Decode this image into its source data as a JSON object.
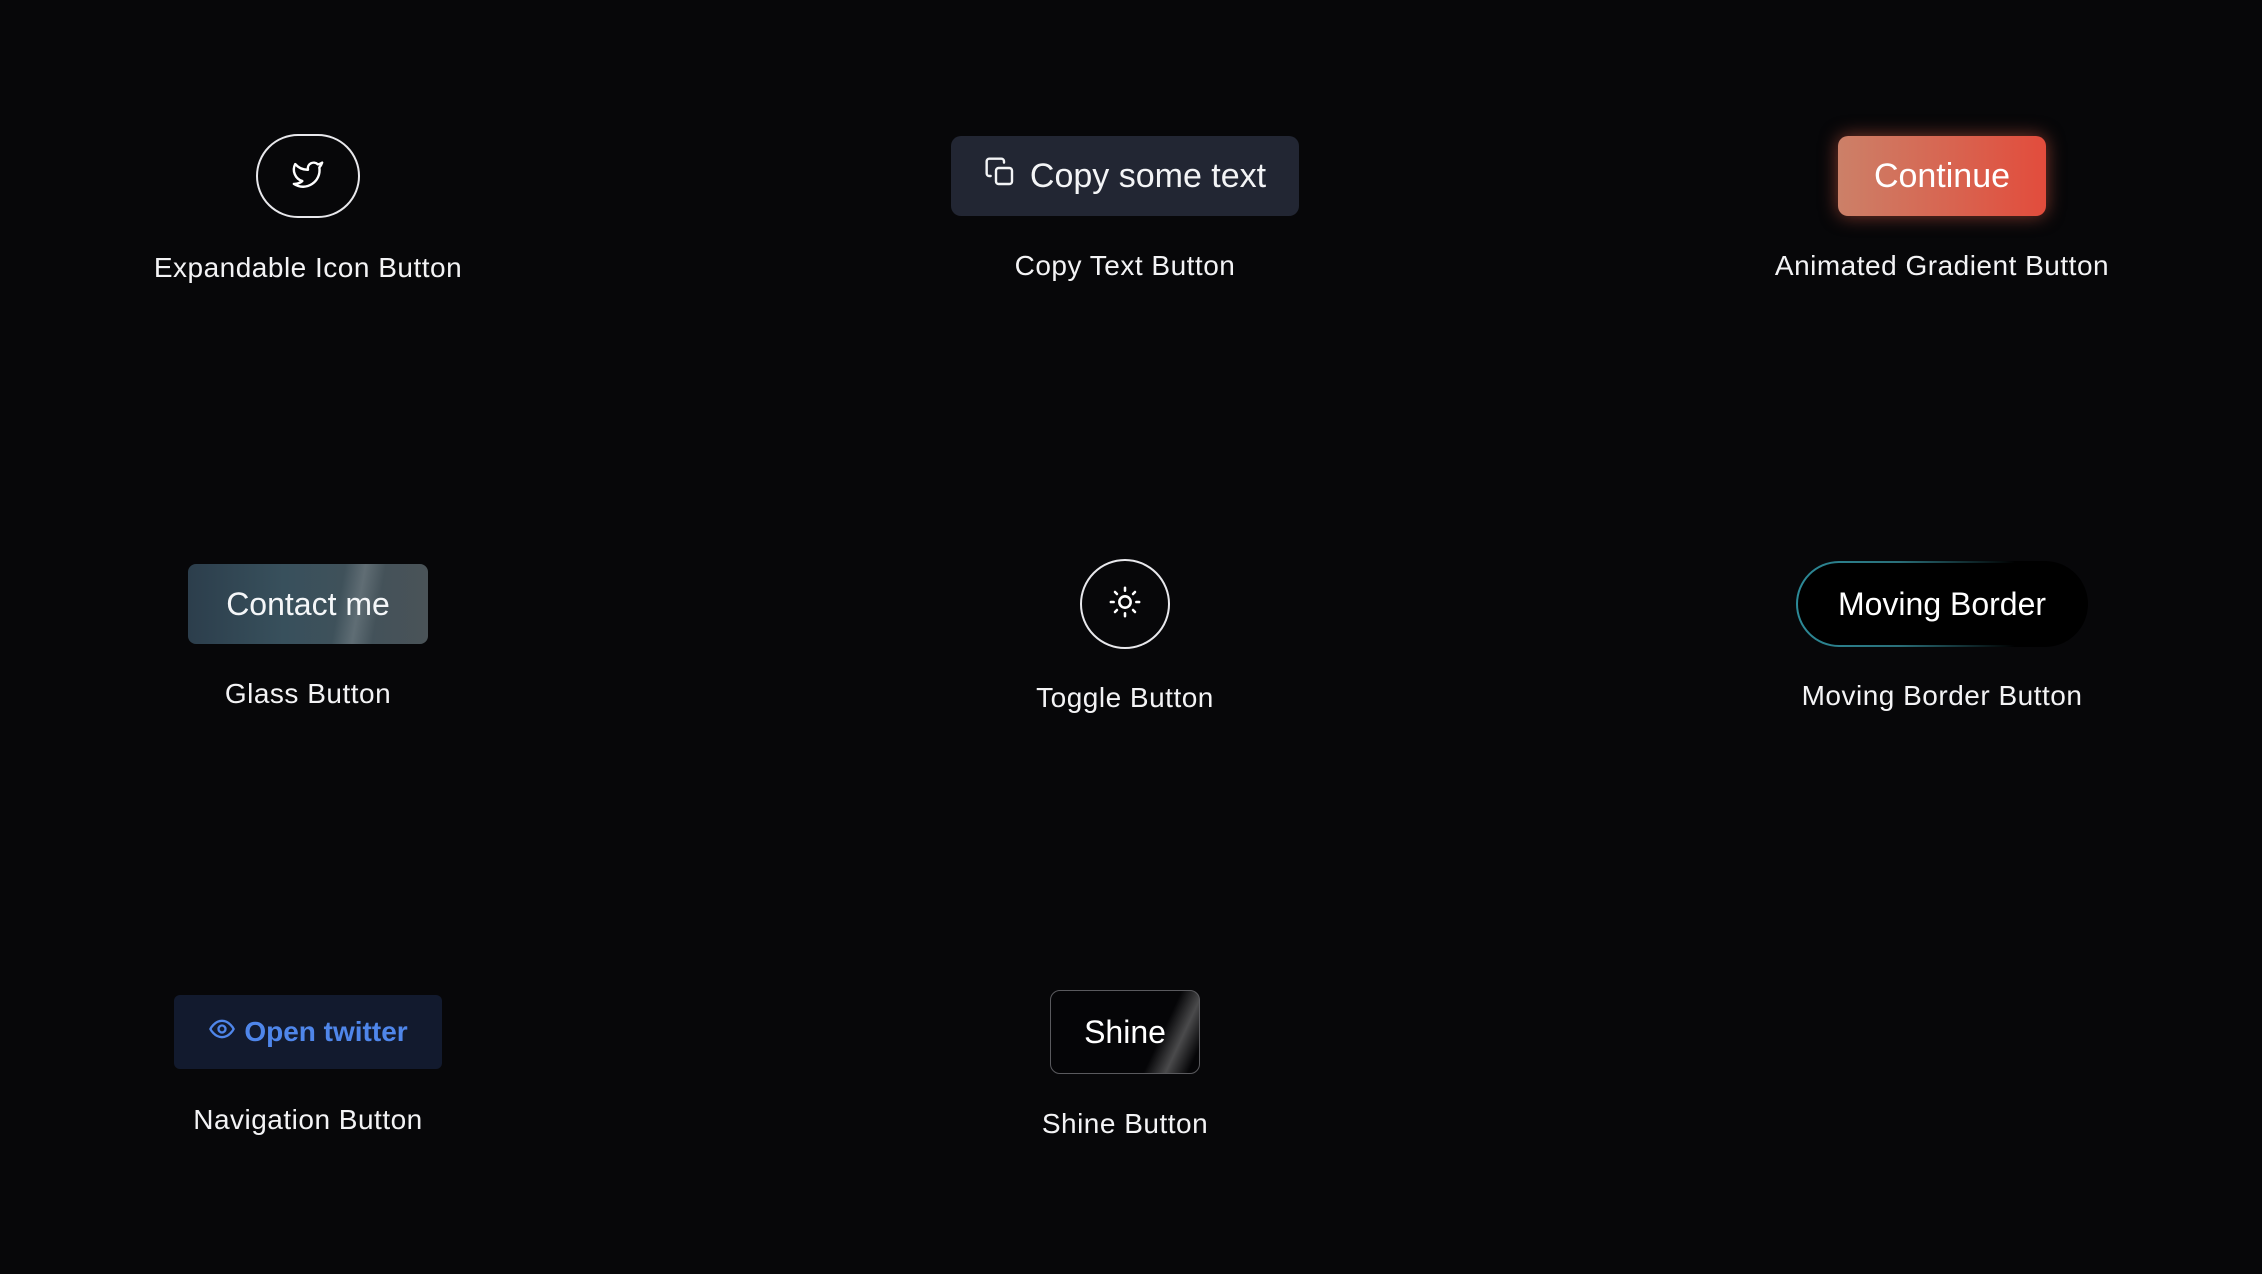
{
  "theme": {
    "background": "#070709",
    "caption_color": "#f3f3f5",
    "accent_blue": "#4f86ea",
    "gradient_red": "#e24c3c",
    "border_teal": "#2c8a98"
  },
  "buttons": {
    "expandable": {
      "caption": "Expandable Icon Button",
      "icon": "twitter-bird-icon"
    },
    "copy_text": {
      "label": "Copy some text",
      "caption": "Copy Text Button",
      "icon": "copy-icon"
    },
    "animated_gradient": {
      "label": "Continue",
      "caption": "Animated Gradient Button"
    },
    "glass": {
      "label": "Contact me",
      "caption": "Glass Button"
    },
    "toggle": {
      "caption": "Toggle Button",
      "icon": "sun-icon"
    },
    "moving_border": {
      "label": "Moving Border",
      "caption": "Moving Border Button"
    },
    "navigation": {
      "label": "Open twitter",
      "caption": "Navigation Button",
      "icon": "eye-icon"
    },
    "shine": {
      "label": "Shine",
      "caption": "Shine Button"
    }
  }
}
